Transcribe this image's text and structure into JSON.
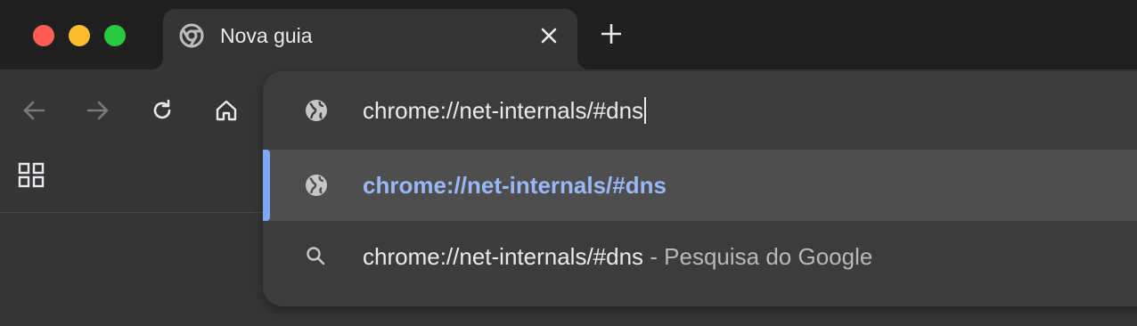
{
  "window": {
    "controls": [
      "close-button",
      "minimize-button",
      "maximize-button"
    ]
  },
  "tab": {
    "title": "Nova guia",
    "icon": "chrome-logo-icon",
    "close_icon": "close-icon"
  },
  "new_tab_icon": "plus-icon",
  "toolbar": {
    "icons": [
      "back-arrow-icon",
      "forward-arrow-icon",
      "reload-icon",
      "home-icon"
    ]
  },
  "bookmarks": {
    "apps_icon": "apps-grid-icon"
  },
  "omnibox": {
    "input_value": "chrome://net-internals/#dns",
    "input_icon": "globe-icon",
    "suggestions": [
      {
        "icon": "globe-icon",
        "text": "chrome://net-internals/#dns",
        "selected": true
      },
      {
        "icon": "search-icon",
        "text": "chrome://net-internals/#dns",
        "separator": " - ",
        "description": "Pesquisa do Google",
        "selected": false
      }
    ]
  },
  "colors": {
    "titlebar": "#202020",
    "toolbar": "#353535",
    "dropdown": "#3c3c3c",
    "selected_row": "#4e4e4e",
    "accent": "#7ea7f5",
    "url_highlight": "#9ab8f7"
  }
}
